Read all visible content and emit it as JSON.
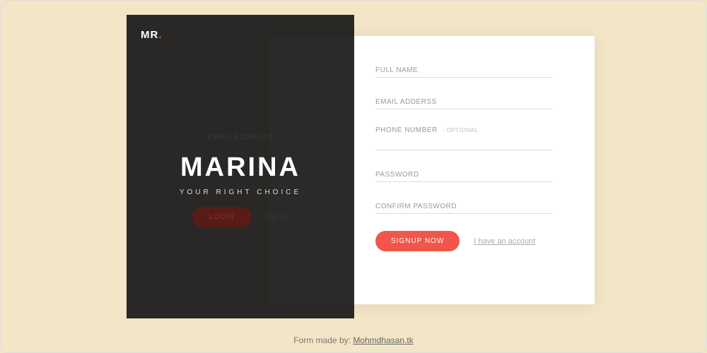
{
  "logo": {
    "text": "MR",
    "dot": "."
  },
  "brand": {
    "title": "MARINA",
    "subtitle": "YOUR RIGHT CHOICE"
  },
  "ghost": {
    "email_label": "EMAIL ADDRESS",
    "login_label": "LOGIN",
    "signup_link": "Sign up"
  },
  "signup": {
    "fields": {
      "fullname": "FULL NAME",
      "email": "EMAIL ADDERSS",
      "phone": "PHONE NUMBER",
      "phone_hint": "- OPTIONAL",
      "password": "PASSWORD",
      "confirm": "CONFIRM PASSWORD"
    },
    "submit_label": "SIGNUP NOW",
    "have_account": "I have an account"
  },
  "footer": {
    "prefix": "Form made by: ",
    "author": "Mohmdhasan.tk"
  }
}
